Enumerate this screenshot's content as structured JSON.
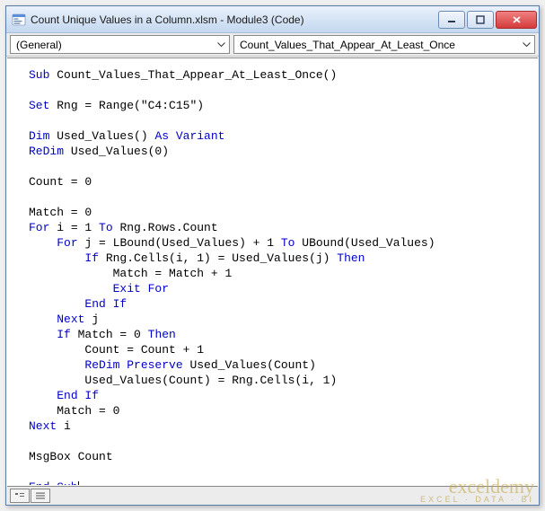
{
  "window": {
    "title": "Count Unique Values in a Column.xlsm - Module3 (Code)"
  },
  "dropdowns": {
    "object": "(General)",
    "procedure": "Count_Values_That_Appear_At_Least_Once"
  },
  "code": {
    "lines": [
      {
        "indent": 0,
        "segs": [
          {
            "t": "Sub ",
            "k": 1
          },
          {
            "t": "Count_Values_That_Appear_At_Least_Once()"
          }
        ]
      },
      {
        "blank": true
      },
      {
        "indent": 0,
        "segs": [
          {
            "t": "Set ",
            "k": 1
          },
          {
            "t": "Rng = Range(\"C4:C15\")"
          }
        ]
      },
      {
        "blank": true
      },
      {
        "indent": 0,
        "segs": [
          {
            "t": "Dim ",
            "k": 1
          },
          {
            "t": "Used_Values() "
          },
          {
            "t": "As Variant",
            "k": 1
          }
        ]
      },
      {
        "indent": 0,
        "segs": [
          {
            "t": "ReDim ",
            "k": 1
          },
          {
            "t": "Used_Values(0)"
          }
        ]
      },
      {
        "blank": true
      },
      {
        "indent": 0,
        "segs": [
          {
            "t": "Count = 0"
          }
        ]
      },
      {
        "blank": true
      },
      {
        "indent": 0,
        "segs": [
          {
            "t": "Match = 0"
          }
        ]
      },
      {
        "indent": 0,
        "segs": [
          {
            "t": "For ",
            "k": 1
          },
          {
            "t": "i = 1 "
          },
          {
            "t": "To ",
            "k": 1
          },
          {
            "t": "Rng.Rows.Count"
          }
        ]
      },
      {
        "indent": 1,
        "segs": [
          {
            "t": "For ",
            "k": 1
          },
          {
            "t": "j = LBound(Used_Values) + 1 "
          },
          {
            "t": "To ",
            "k": 1
          },
          {
            "t": "UBound(Used_Values)"
          }
        ]
      },
      {
        "indent": 2,
        "segs": [
          {
            "t": "If ",
            "k": 1
          },
          {
            "t": "Rng.Cells(i, 1) = Used_Values(j) "
          },
          {
            "t": "Then",
            "k": 1
          }
        ]
      },
      {
        "indent": 3,
        "segs": [
          {
            "t": "Match = Match + 1"
          }
        ]
      },
      {
        "indent": 3,
        "segs": [
          {
            "t": "Exit For",
            "k": 1
          }
        ]
      },
      {
        "indent": 2,
        "segs": [
          {
            "t": "End If",
            "k": 1
          }
        ]
      },
      {
        "indent": 1,
        "segs": [
          {
            "t": "Next ",
            "k": 1
          },
          {
            "t": "j"
          }
        ]
      },
      {
        "indent": 1,
        "segs": [
          {
            "t": "If ",
            "k": 1
          },
          {
            "t": "Match = 0 "
          },
          {
            "t": "Then",
            "k": 1
          }
        ]
      },
      {
        "indent": 2,
        "segs": [
          {
            "t": "Count = Count + 1"
          }
        ]
      },
      {
        "indent": 2,
        "segs": [
          {
            "t": "ReDim Preserve ",
            "k": 1
          },
          {
            "t": "Used_Values(Count)"
          }
        ]
      },
      {
        "indent": 2,
        "segs": [
          {
            "t": "Used_Values(Count) = Rng.Cells(i, 1)"
          }
        ]
      },
      {
        "indent": 1,
        "segs": [
          {
            "t": "End If",
            "k": 1
          }
        ]
      },
      {
        "indent": 1,
        "segs": [
          {
            "t": "Match = 0"
          }
        ]
      },
      {
        "indent": 0,
        "segs": [
          {
            "t": "Next ",
            "k": 1
          },
          {
            "t": "i"
          }
        ]
      },
      {
        "blank": true
      },
      {
        "indent": 0,
        "segs": [
          {
            "t": "MsgBox Count"
          }
        ]
      },
      {
        "blank": true
      },
      {
        "indent": 0,
        "segs": [
          {
            "t": "End Sub",
            "k": 1
          }
        ],
        "cursor": true
      }
    ]
  },
  "watermark": {
    "name": "exceldemy",
    "tagline": "EXCEL · DATA · BI"
  }
}
